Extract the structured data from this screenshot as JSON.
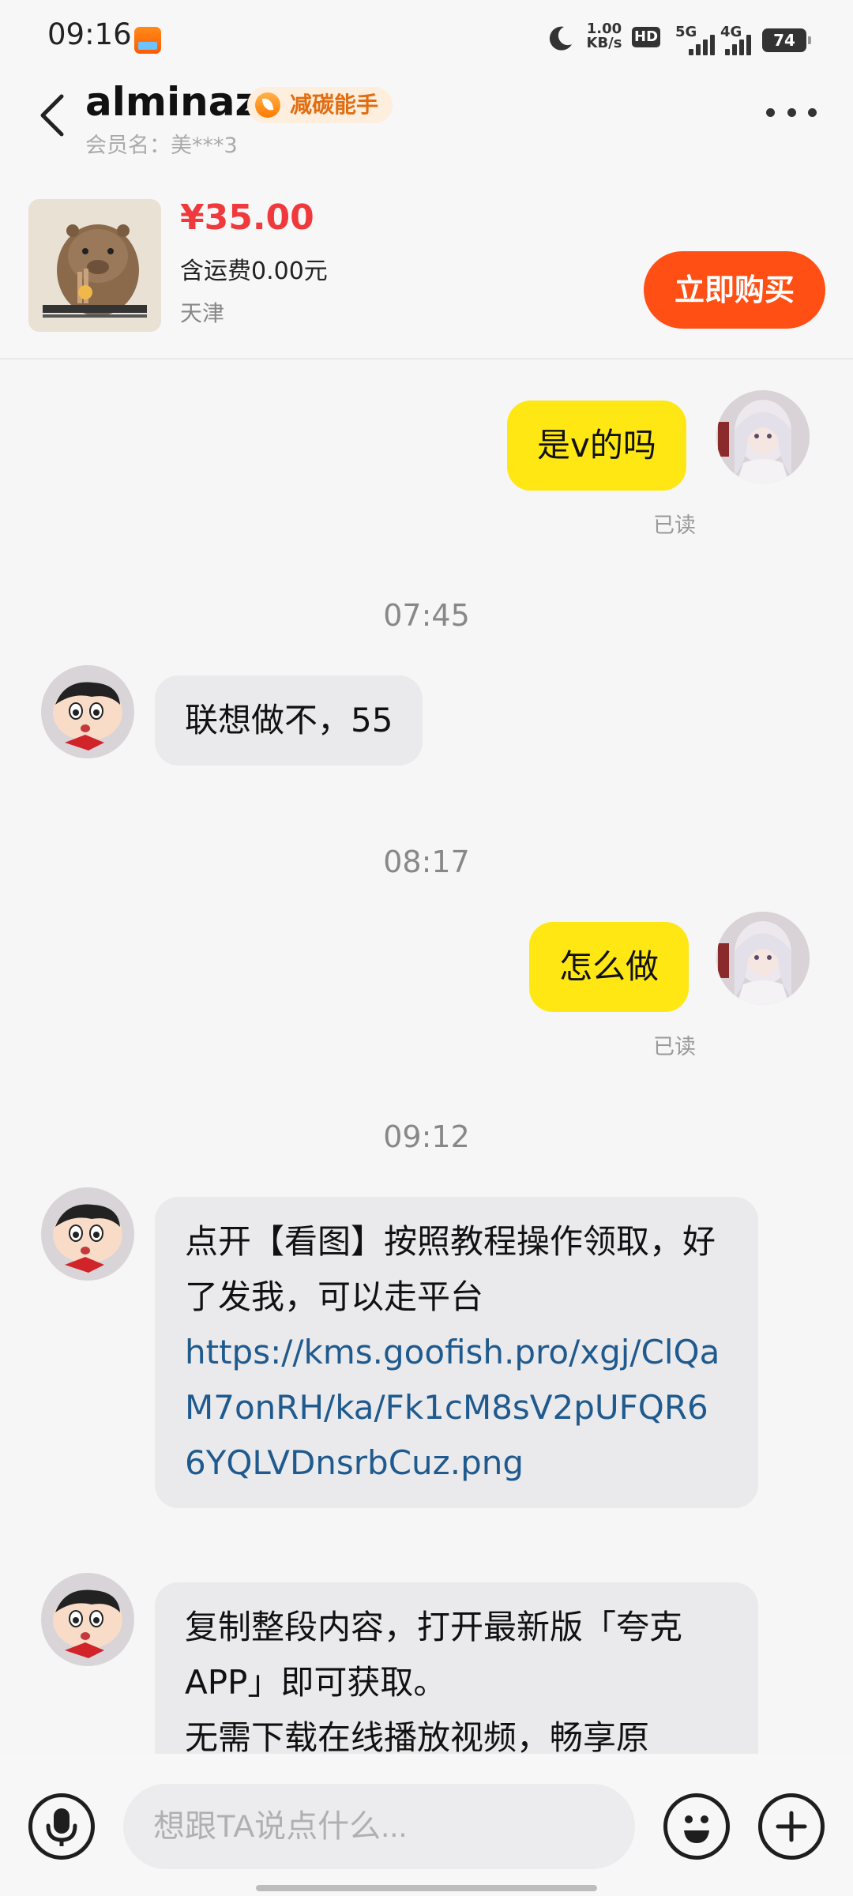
{
  "status_bar": {
    "time": "09:16",
    "net_speed_value": "1.00",
    "net_speed_unit": "KB/s",
    "hd_label": "HD",
    "sim1_label": "5G",
    "sim2_label": "4G",
    "battery": "74"
  },
  "header": {
    "name": "alminaz",
    "badge": "减碳能手",
    "member": "会员名：美***3"
  },
  "product": {
    "price": "¥35.00",
    "shipping": "含运费0.00元",
    "location": "天津",
    "buy_label": "立即购买"
  },
  "messages": {
    "m1": {
      "text": "是v的吗",
      "status": "已读"
    },
    "t1": "07:45",
    "m2": {
      "text": "联想做不，55"
    },
    "t2": "08:17",
    "m3": {
      "text": "怎么做",
      "status": "已读"
    },
    "t3": "09:12",
    "m4": {
      "text": "点开【看图】按照教程操作领取，好了发我，可以走平台",
      "link": "https://kms.goofish.pro/xgj/ClQaM7onRH/ka/Fk1cM8sV2pUFQR66YQLVDnsrbCuz.png"
    },
    "m5": {
      "line1": "复制整段内容，打开最新版「夸克APP」即可获取。",
      "line2": "无需下载在线播放视频，畅享原"
    }
  },
  "input": {
    "placeholder": "想跟TA说点什么..."
  }
}
